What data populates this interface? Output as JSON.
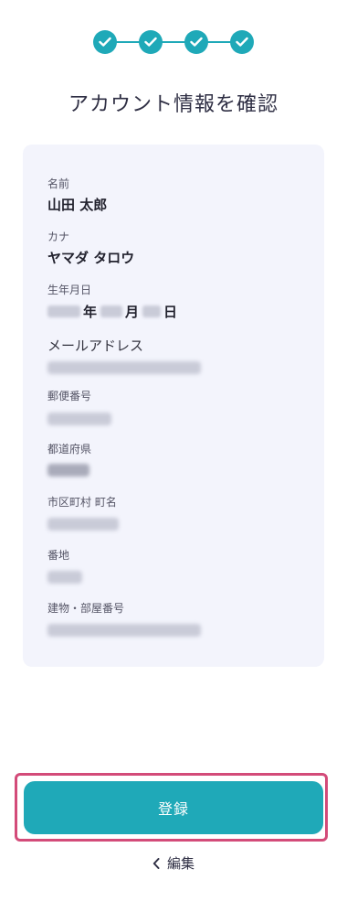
{
  "stepper": {
    "steps": 4,
    "completed": 4
  },
  "page_title": "アカウント情報を確認",
  "fields": {
    "name": {
      "label": "名前",
      "value": "山田 太郎"
    },
    "kana": {
      "label": "カナ",
      "value": "ヤマダ タロウ"
    },
    "birthdate": {
      "label": "生年月日",
      "year_unit": "年",
      "month_unit": "月",
      "day_unit": "日"
    },
    "email": {
      "label": "メールアドレス"
    },
    "postal_code": {
      "label": "郵便番号"
    },
    "prefecture": {
      "label": "都道府県"
    },
    "city": {
      "label": "市区町村 町名"
    },
    "street_number": {
      "label": "番地"
    },
    "building": {
      "label": "建物・部屋番号"
    }
  },
  "actions": {
    "submit_label": "登録",
    "edit_label": "編集"
  },
  "colors": {
    "accent": "#1fa9b8",
    "highlight_border": "#d34b79",
    "card_bg": "#f3f4fc"
  },
  "icons": {
    "step": "check-icon",
    "back": "chevron-left-icon"
  }
}
